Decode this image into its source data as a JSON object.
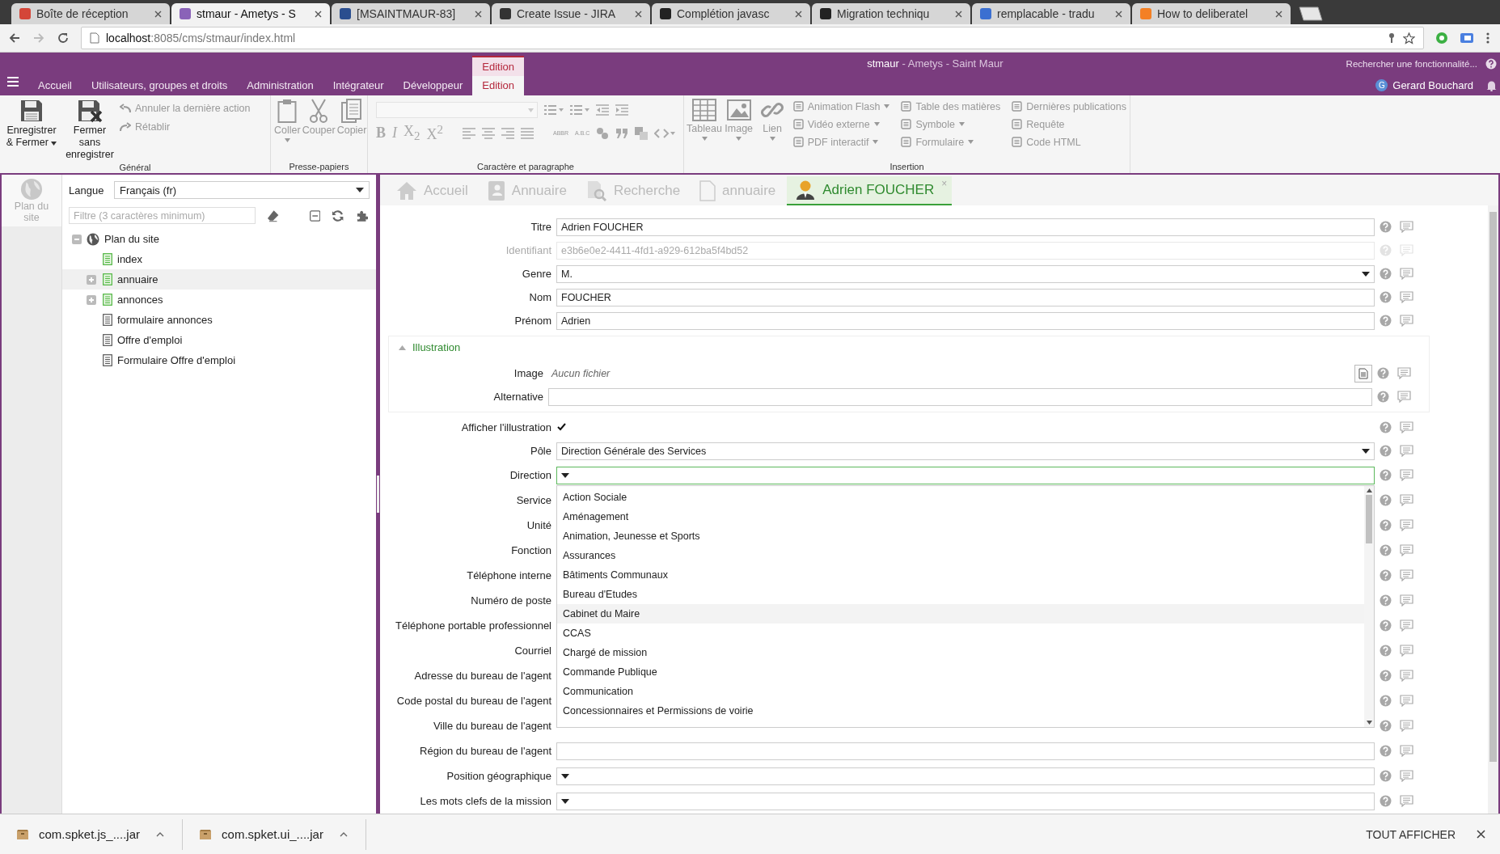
{
  "browser": {
    "tabs": [
      {
        "title": "Boîte de réception",
        "color": "#d44638",
        "selected": false
      },
      {
        "title": "stmaur - Ametys - S",
        "color": "#8a63b8",
        "selected": true
      },
      {
        "title": "[MSAINTMAUR-83]",
        "color": "#2a4e8f",
        "selected": false
      },
      {
        "title": "Create Issue - JIRA",
        "color": "#333333",
        "selected": false
      },
      {
        "title": "Complétion javasc",
        "color": "#222222",
        "selected": false
      },
      {
        "title": "Migration techniqu",
        "color": "#222222",
        "selected": false
      },
      {
        "title": "remplacable - tradu",
        "color": "#3b6fd1",
        "selected": false
      },
      {
        "title": "How to deliberatel",
        "color": "#f48024",
        "selected": false
      }
    ],
    "address": {
      "host": "localhost",
      "path": ":8085/cms/stmaur/index.html"
    }
  },
  "app": {
    "contextual_label": "Edition",
    "menu": [
      {
        "label": "Accueil",
        "selected": false
      },
      {
        "label": "Utilisateurs, groupes et droits",
        "selected": false
      },
      {
        "label": "Administration",
        "selected": false
      },
      {
        "label": "Intégrateur",
        "selected": false
      },
      {
        "label": "Développeur",
        "selected": false
      },
      {
        "label": "Edition",
        "selected": true
      }
    ],
    "title": {
      "site": "stmaur",
      "rest": "- Ametys - Saint Maur"
    },
    "search": "Rechercher une fonctionnalité...",
    "user": {
      "initial": "G",
      "name": "Gerard Bouchard"
    }
  },
  "ribbon": {
    "general": {
      "title": "Général",
      "save": {
        "label": "Enregistrer & Fermer",
        "disabled": false
      },
      "close": {
        "label": "Fermer sans enregistrer",
        "disabled": false
      },
      "undo": {
        "label": "Annuler la dernière action",
        "disabled": true
      },
      "redo": {
        "label": "Rétablir",
        "disabled": true
      }
    },
    "clipboard": {
      "title": "Presse-papiers",
      "paste": {
        "label": "Coller",
        "disabled": true
      },
      "cut": {
        "label": "Couper",
        "disabled": true
      },
      "copy": {
        "label": "Copier",
        "disabled": true
      }
    },
    "format": {
      "title": "Caractère et paragraphe",
      "text_buttons": [
        "B",
        "I",
        "X$_{2}$",
        "X$^{2}$"
      ],
      "abbr": "ABBR",
      "acronym": "A.B.C"
    },
    "insertion": {
      "title": "Insertion",
      "large": [
        "Tableau",
        "Image",
        "Lien"
      ],
      "small": [
        {
          "label": "Animation Flash",
          "caret": true
        },
        {
          "label": "Vidéo externe",
          "caret": true
        },
        {
          "label": "PDF interactif",
          "caret": true
        },
        {
          "label": "Table des matières",
          "caret": false
        },
        {
          "label": "Symbole",
          "caret": true
        },
        {
          "label": "Formulaire",
          "caret": true
        },
        {
          "label": "Dernières publications",
          "caret": false
        },
        {
          "label": "Requête",
          "caret": false
        },
        {
          "label": "Code HTML",
          "caret": false
        }
      ]
    }
  },
  "sidebar": {
    "items": [
      {
        "label": "Plan du site",
        "selected": true
      }
    ]
  },
  "sitemap": {
    "language_label": "Langue",
    "language": "Français (fr)",
    "filter_placeholder": "Filtre (3 caractères minimum)",
    "tree": {
      "label": "Plan du site",
      "expanded": true,
      "children": [
        {
          "label": "index",
          "kind": "page",
          "selected": false
        },
        {
          "label": "annuaire",
          "kind": "page",
          "selected": true,
          "expanded": false
        },
        {
          "label": "annonces",
          "kind": "page",
          "selected": false,
          "expanded": false
        },
        {
          "label": "formulaire annonces",
          "kind": "resource",
          "selected": false
        },
        {
          "label": "Offre d'emploi",
          "kind": "resource",
          "selected": false
        },
        {
          "label": "Formulaire Offre d'emploi",
          "kind": "resource",
          "selected": false
        }
      ]
    }
  },
  "content_tabs": [
    {
      "label": "Accueil",
      "selected": false
    },
    {
      "label": "Annuaire",
      "selected": false
    },
    {
      "label": "Recherche",
      "selected": false
    },
    {
      "label": "annuaire",
      "selected": false
    },
    {
      "label": "Adrien FOUCHER",
      "selected": true,
      "close": "×"
    }
  ],
  "form": {
    "rows": [
      {
        "label": "Titre",
        "kind": "text",
        "value": "Adrien FOUCHER",
        "disabled": false
      },
      {
        "label": "Identifiant",
        "kind": "text",
        "value": "e3b6e0e2-4411-4fd1-a929-612ba5f4bd52",
        "disabled": true
      },
      {
        "label": "Genre",
        "kind": "select",
        "value": "M.",
        "disabled": false,
        "open": false
      },
      {
        "label": "Nom",
        "kind": "text",
        "value": "FOUCHER",
        "disabled": false
      },
      {
        "label": "Prénom",
        "kind": "text",
        "value": "Adrien",
        "disabled": false
      }
    ],
    "illustration": {
      "title": "Illustration",
      "expanded": true,
      "rows": [
        {
          "label": "Image",
          "kind": "file",
          "placeholder": "Aucun fichier",
          "disabled": false
        },
        {
          "label": "Alternative",
          "kind": "text",
          "disabled": false
        }
      ]
    },
    "more_rows": [
      {
        "label": "Afficher l'illustration",
        "kind": "checkbox",
        "checked": true,
        "disabled": false
      },
      {
        "label": "Pôle",
        "kind": "select",
        "value": "Direction Générale des Services",
        "disabled": false,
        "open": false
      },
      {
        "label": "Direction",
        "kind": "select",
        "disabled": false,
        "open": true,
        "options": [
          {
            "label": "Action Sociale",
            "highlighted": false
          },
          {
            "label": "Aménagement",
            "highlighted": false
          },
          {
            "label": "Animation, Jeunesse et Sports",
            "highlighted": false
          },
          {
            "label": "Assurances",
            "highlighted": false
          },
          {
            "label": "Bâtiments Communaux",
            "highlighted": false
          },
          {
            "label": "Bureau d'Etudes",
            "highlighted": false
          },
          {
            "label": "Cabinet du Maire",
            "highlighted": true
          },
          {
            "label": "CCAS",
            "highlighted": false
          },
          {
            "label": "Chargé de mission",
            "highlighted": false
          },
          {
            "label": "Commande Publique",
            "highlighted": false
          },
          {
            "label": "Communication",
            "highlighted": false
          },
          {
            "label": "Concessionnaires et Permissions de voirie",
            "highlighted": false
          }
        ]
      },
      {
        "label": "Service",
        "kind": "covered",
        "disabled": false
      },
      {
        "label": "Unité",
        "kind": "covered",
        "disabled": false
      },
      {
        "label": "Fonction",
        "kind": "covered",
        "disabled": false
      },
      {
        "label": "Téléphone interne",
        "kind": "covered",
        "disabled": false
      },
      {
        "label": "Numéro de poste",
        "kind": "covered",
        "disabled": false
      },
      {
        "label": "Téléphone portable professionnel",
        "kind": "covered",
        "disabled": false
      },
      {
        "label": "Courriel",
        "kind": "covered",
        "disabled": false
      },
      {
        "label": "Adresse du bureau de l'agent",
        "kind": "covered",
        "disabled": false
      },
      {
        "label": "Code postal du bureau de l'agent",
        "kind": "covered",
        "disabled": false
      },
      {
        "label": "Ville du bureau de l'agent",
        "kind": "covered",
        "disabled": false
      },
      {
        "label": "Région du bureau de l'agent",
        "kind": "text",
        "disabled": false
      },
      {
        "label": "Position géographique",
        "kind": "select",
        "disabled": false,
        "open": false
      },
      {
        "label": "Les mots clefs de la mission",
        "kind": "select",
        "disabled": false,
        "open": false
      }
    ]
  },
  "downloads": {
    "items": [
      "com.spket.js_....jar",
      "com.spket.ui_....jar"
    ],
    "show_all": "TOUT AFFICHER"
  }
}
